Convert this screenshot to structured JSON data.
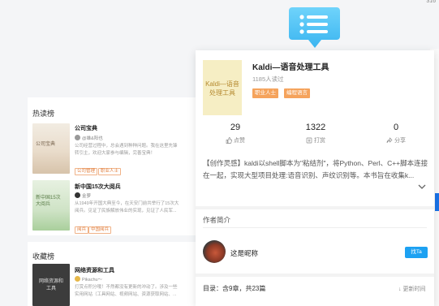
{
  "background": {
    "top_right_fragment": "316",
    "hot_list_title": "热读榜",
    "favorites_title": "收藏榜",
    "book1": {
      "cover_text": "公司宝典",
      "title": "公司宝典",
      "author": "@雄&阳也",
      "desc_line1": "公司经营过程中，总会遇到种种问题。我在这里先锋",
      "desc_line2": "转引主，欢迎大家参与编辑，完善宝典！",
      "tags": [
        "公司管理",
        "职业人士"
      ]
    },
    "book2": {
      "cover_text_line1": "新中国15次",
      "cover_text_line2": "大阅兵",
      "title": "新中国15次大阅兵",
      "author": "金萝",
      "desc_line1": "从1949年开国大典至今，在天安门前共举行了15次大",
      "desc_line2": "阅兵。见证了民族解放伟业的实现，见证了人民军...",
      "tags": [
        "阅兵",
        "中国阅兵"
      ]
    },
    "book3": {
      "cover_text_line1": "网络资源和",
      "cover_text_line2": "工具",
      "title": "网络资源和工具",
      "author": "Pikachu～",
      "desc_line1": "打赏点积分哦！不然都没有更新的冲动了。涉及一些",
      "desc_line2": "实用网站（工具网站、视频网站、资源获取网站、..."
    }
  },
  "popup": {
    "cover_text_line1": "Kaldi—语音",
    "cover_text_line2": "处理工具",
    "title": "Kaldi—语音处理工具",
    "readers": "1185人读过",
    "tags": [
      "职业人士",
      "编程语言"
    ],
    "stats": [
      {
        "value": "29",
        "label": "点赞",
        "icon": "thumbs-up-icon"
      },
      {
        "value": "1322",
        "label": "打赏",
        "icon": "reward-icon"
      },
      {
        "value": "0",
        "label": "分享",
        "icon": "share-icon"
      }
    ],
    "description": "【创作灵感】kaldi以shell脚本为\"粘结剂\"，将Python、Perl、C++脚本连接在一起，实现大型项目处理:语音识别、声纹识别等。本书旨在收集k...",
    "author_section_title": "作者简介",
    "author_name": "这是昵称",
    "ask_button": "找Ta",
    "toc_label": "目录：含9章，共23篇",
    "toc_order": "↓ 更新时间"
  },
  "colors": {
    "accent_blue": "#1da1f2",
    "tag_orange": "#f5a35c",
    "chat_icon_blue": "#4cc3f6"
  }
}
